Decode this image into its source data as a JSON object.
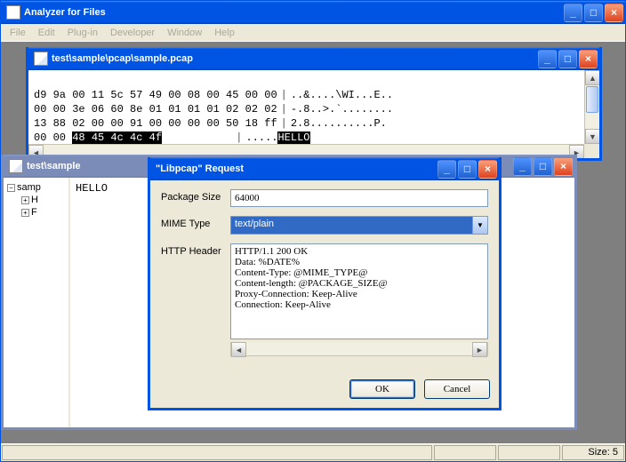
{
  "app": {
    "title": "Analyzer for Files"
  },
  "menubar": [
    "File",
    "Edit",
    "Plug-in",
    "Developer",
    "Window",
    "Help"
  ],
  "hex_window": {
    "title": "test\\sample\\pcap\\sample.pcap",
    "rows": [
      {
        "hex": "d9 9a 00 11 5c 57 49 00 08 00 45 00 00",
        "ascii": "..&....\\WI...E.."
      },
      {
        "hex": "00 00 3e 06 60 8e 01 01 01 01 02 02 02",
        "ascii": "-.8..>.`........"
      },
      {
        "hex": "13 88 02 00 00 91 00 00 00 00 50 18 ff",
        "ascii": "2.8..........P."
      },
      {
        "hex": "00 00 ",
        "hex_sel": "48 45 4c 4c 4f",
        "ascii": ".....",
        "ascii_sel": "HELLO"
      }
    ]
  },
  "tree_window": {
    "title": "test\\sample",
    "tree": {
      "root": "samp",
      "children": [
        "H",
        "F"
      ]
    },
    "content": "HELLO"
  },
  "dialog": {
    "title": "\"Libpcap\" Request",
    "labels": {
      "package_size": "Package Size",
      "mime_type": "MIME Type",
      "http_header": "HTTP Header"
    },
    "values": {
      "package_size": "64000",
      "mime_type": "text/plain",
      "http_header": "HTTP/1.1 200 OK\nData: %DATE%\nContent-Type: @MIME_TYPE@\nContent-length: @PACKAGE_SIZE@\nProxy-Connection: Keep-Alive\nConnection: Keep-Alive"
    },
    "buttons": {
      "ok": "OK",
      "cancel": "Cancel"
    }
  },
  "statusbar": {
    "size_label": "Size: 5"
  }
}
